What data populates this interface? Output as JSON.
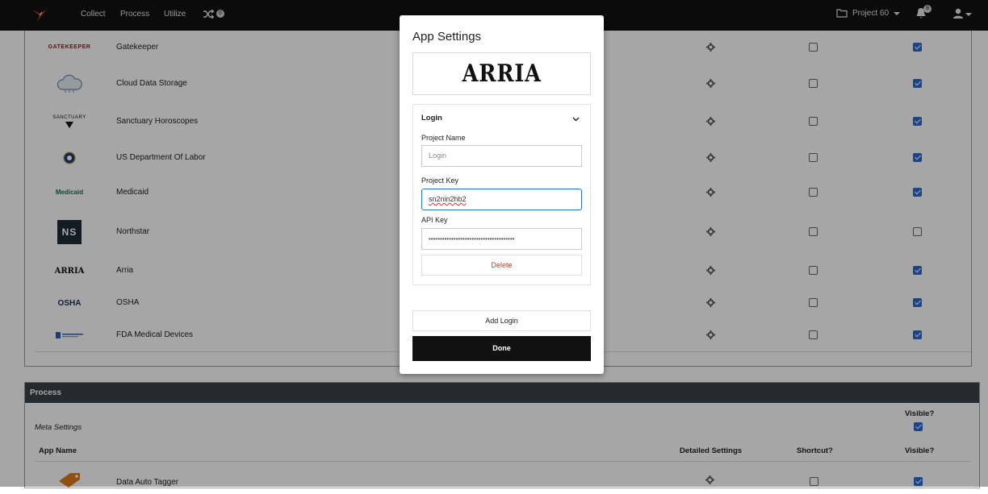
{
  "nav": {
    "links": [
      "Collect",
      "Process",
      "Utilize"
    ],
    "shuffle_badge": "0",
    "project": "Project 60",
    "notif_badge": "8"
  },
  "apps": [
    {
      "name": "Gatekeeper",
      "logo": "GATEKEEPER",
      "shortcut": false,
      "visible": true
    },
    {
      "name": "Cloud Data Storage",
      "logo": "",
      "shortcut": false,
      "visible": true
    },
    {
      "name": "Sanctuary Horoscopes",
      "logo": "SANCTUARY",
      "shortcut": false,
      "visible": true
    },
    {
      "name": "US Department Of Labor",
      "logo": "",
      "shortcut": false,
      "visible": true
    },
    {
      "name": "Medicaid",
      "logo": "Medicaid",
      "shortcut": false,
      "visible": true
    },
    {
      "name": "Northstar",
      "logo": "NS",
      "shortcut": false,
      "visible": false
    },
    {
      "name": "Arria",
      "logo": "ARRIA",
      "shortcut": false,
      "visible": true
    },
    {
      "name": "OSHA",
      "logo": "OSHA",
      "shortcut": false,
      "visible": true
    },
    {
      "name": "FDA Medical Devices",
      "logo": "",
      "shortcut": false,
      "visible": true
    }
  ],
  "process": {
    "header": "Process",
    "meta_settings": "Meta Settings",
    "visible_label": "Visible?",
    "columns": {
      "app_name": "App Name",
      "detailed": "Detailed Settings",
      "shortcut": "Shortcut?",
      "visible": "Visible?"
    },
    "rows": [
      {
        "name": "Data Auto Tagger"
      }
    ]
  },
  "modal": {
    "title": "App Settings",
    "logo_text": "ARRIA",
    "section": "Login",
    "project_name_label": "Project Name",
    "project_name_placeholder": "Login",
    "project_key_label": "Project Key",
    "project_key_value": "sn2nin2hb2",
    "api_key_label": "API Key",
    "api_key_value": "••••••••••••••••••••••••••••••••••••••",
    "delete_label": "Delete",
    "add_login_label": "Add Login",
    "done_label": "Done"
  },
  "colors": {
    "accent": "#2a6bd1",
    "danger": "#c0392b",
    "nav_bg": "#111111",
    "section_header": "#3b4149"
  }
}
